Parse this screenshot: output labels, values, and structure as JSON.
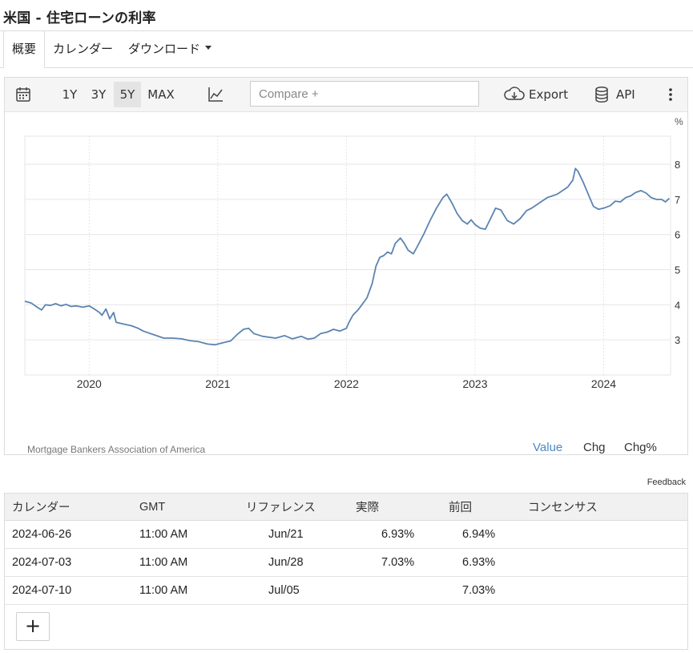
{
  "page_title": "米国 - 住宅ローンの利率",
  "tabs": [
    {
      "label": "概要",
      "active": true
    },
    {
      "label": "カレンダー",
      "active": false
    },
    {
      "label": "ダウンロード",
      "active": false,
      "has_dropdown": true
    }
  ],
  "toolbar": {
    "calendar_icon": "calendar-icon",
    "ranges": [
      "1Y",
      "3Y",
      "5Y",
      "MAX"
    ],
    "selected_range": "5Y",
    "chart_type_icon": "line-chart-icon",
    "compare_placeholder": "Compare +",
    "export_label": "Export",
    "export_icon": "cloud-download-icon",
    "api_label": "API",
    "api_icon": "database-icon",
    "more_icon": "more-vertical-icon"
  },
  "chart_data": {
    "type": "line",
    "unit_label": "%",
    "x_ticks": [
      "2020",
      "2021",
      "2022",
      "2023",
      "2024"
    ],
    "y_ticks": [
      3,
      4,
      5,
      6,
      7,
      8
    ],
    "ylim": [
      2.0,
      8.8
    ],
    "xlim": [
      2019.5,
      2024.52
    ],
    "grid": true,
    "line_color": "#5b84b1",
    "series": [
      {
        "name": "",
        "points": [
          [
            2019.5,
            4.1
          ],
          [
            2019.55,
            4.05
          ],
          [
            2019.6,
            3.92
          ],
          [
            2019.63,
            3.85
          ],
          [
            2019.66,
            4.0
          ],
          [
            2019.7,
            3.98
          ],
          [
            2019.74,
            4.03
          ],
          [
            2019.78,
            3.97
          ],
          [
            2019.82,
            4.01
          ],
          [
            2019.86,
            3.95
          ],
          [
            2019.9,
            3.97
          ],
          [
            2019.95,
            3.93
          ],
          [
            2020.0,
            3.97
          ],
          [
            2020.04,
            3.88
          ],
          [
            2020.08,
            3.78
          ],
          [
            2020.1,
            3.7
          ],
          [
            2020.13,
            3.88
          ],
          [
            2020.16,
            3.6
          ],
          [
            2020.19,
            3.78
          ],
          [
            2020.21,
            3.5
          ],
          [
            2020.27,
            3.45
          ],
          [
            2020.33,
            3.4
          ],
          [
            2020.38,
            3.33
          ],
          [
            2020.42,
            3.25
          ],
          [
            2020.5,
            3.15
          ],
          [
            2020.58,
            3.05
          ],
          [
            2020.65,
            3.05
          ],
          [
            2020.72,
            3.03
          ],
          [
            2020.78,
            2.98
          ],
          [
            2020.85,
            2.95
          ],
          [
            2020.92,
            2.88
          ],
          [
            2020.98,
            2.86
          ],
          [
            2021.04,
            2.92
          ],
          [
            2021.1,
            2.97
          ],
          [
            2021.15,
            3.15
          ],
          [
            2021.2,
            3.3
          ],
          [
            2021.24,
            3.33
          ],
          [
            2021.28,
            3.18
          ],
          [
            2021.35,
            3.1
          ],
          [
            2021.45,
            3.05
          ],
          [
            2021.52,
            3.12
          ],
          [
            2021.58,
            3.03
          ],
          [
            2021.65,
            3.1
          ],
          [
            2021.7,
            3.02
          ],
          [
            2021.75,
            3.05
          ],
          [
            2021.8,
            3.18
          ],
          [
            2021.85,
            3.22
          ],
          [
            2021.9,
            3.3
          ],
          [
            2021.95,
            3.25
          ],
          [
            2022.0,
            3.33
          ],
          [
            2022.02,
            3.5
          ],
          [
            2022.05,
            3.7
          ],
          [
            2022.09,
            3.85
          ],
          [
            2022.12,
            4.0
          ],
          [
            2022.16,
            4.2
          ],
          [
            2022.2,
            4.6
          ],
          [
            2022.23,
            5.1
          ],
          [
            2022.26,
            5.35
          ],
          [
            2022.29,
            5.4
          ],
          [
            2022.32,
            5.5
          ],
          [
            2022.35,
            5.45
          ],
          [
            2022.38,
            5.75
          ],
          [
            2022.42,
            5.9
          ],
          [
            2022.45,
            5.75
          ],
          [
            2022.48,
            5.55
          ],
          [
            2022.52,
            5.45
          ],
          [
            2022.55,
            5.65
          ],
          [
            2022.6,
            6.0
          ],
          [
            2022.65,
            6.4
          ],
          [
            2022.7,
            6.75
          ],
          [
            2022.75,
            7.05
          ],
          [
            2022.78,
            7.15
          ],
          [
            2022.82,
            6.9
          ],
          [
            2022.86,
            6.6
          ],
          [
            2022.9,
            6.4
          ],
          [
            2022.94,
            6.3
          ],
          [
            2022.97,
            6.42
          ],
          [
            2023.0,
            6.28
          ],
          [
            2023.04,
            6.18
          ],
          [
            2023.08,
            6.15
          ],
          [
            2023.12,
            6.45
          ],
          [
            2023.16,
            6.75
          ],
          [
            2023.2,
            6.7
          ],
          [
            2023.25,
            6.4
          ],
          [
            2023.3,
            6.3
          ],
          [
            2023.35,
            6.45
          ],
          [
            2023.4,
            6.68
          ],
          [
            2023.44,
            6.75
          ],
          [
            2023.48,
            6.85
          ],
          [
            2023.52,
            6.95
          ],
          [
            2023.56,
            7.05
          ],
          [
            2023.6,
            7.1
          ],
          [
            2023.64,
            7.15
          ],
          [
            2023.68,
            7.25
          ],
          [
            2023.72,
            7.35
          ],
          [
            2023.76,
            7.55
          ],
          [
            2023.78,
            7.88
          ],
          [
            2023.8,
            7.8
          ],
          [
            2023.84,
            7.5
          ],
          [
            2023.88,
            7.15
          ],
          [
            2023.92,
            6.8
          ],
          [
            2023.96,
            6.72
          ],
          [
            2024.0,
            6.75
          ],
          [
            2024.05,
            6.82
          ],
          [
            2024.09,
            6.95
          ],
          [
            2024.13,
            6.93
          ],
          [
            2024.17,
            7.05
          ],
          [
            2024.21,
            7.1
          ],
          [
            2024.25,
            7.2
          ],
          [
            2024.29,
            7.25
          ],
          [
            2024.33,
            7.18
          ],
          [
            2024.37,
            7.05
          ],
          [
            2024.41,
            7.0
          ],
          [
            2024.45,
            7.0
          ],
          [
            2024.48,
            6.93
          ],
          [
            2024.51,
            7.03
          ]
        ]
      }
    ],
    "source": "Mortgage Bankers Association of America",
    "view_modes": [
      "Value",
      "Chg",
      "Chg%"
    ],
    "active_view_mode": "Value",
    "feedback_label": "Feedback"
  },
  "calendar_table": {
    "headers": [
      "カレンダー",
      "GMT",
      "リファレンス",
      "実際",
      "前回",
      "コンセンサス"
    ],
    "rows": [
      [
        "2024-06-26",
        "11:00 AM",
        "Jun/21",
        "6.93%",
        "6.94%",
        ""
      ],
      [
        "2024-07-03",
        "11:00 AM",
        "Jun/28",
        "7.03%",
        "6.93%",
        ""
      ],
      [
        "2024-07-10",
        "11:00 AM",
        "Jul/05",
        "",
        "7.03%",
        ""
      ]
    ],
    "add_button_label": "+"
  }
}
